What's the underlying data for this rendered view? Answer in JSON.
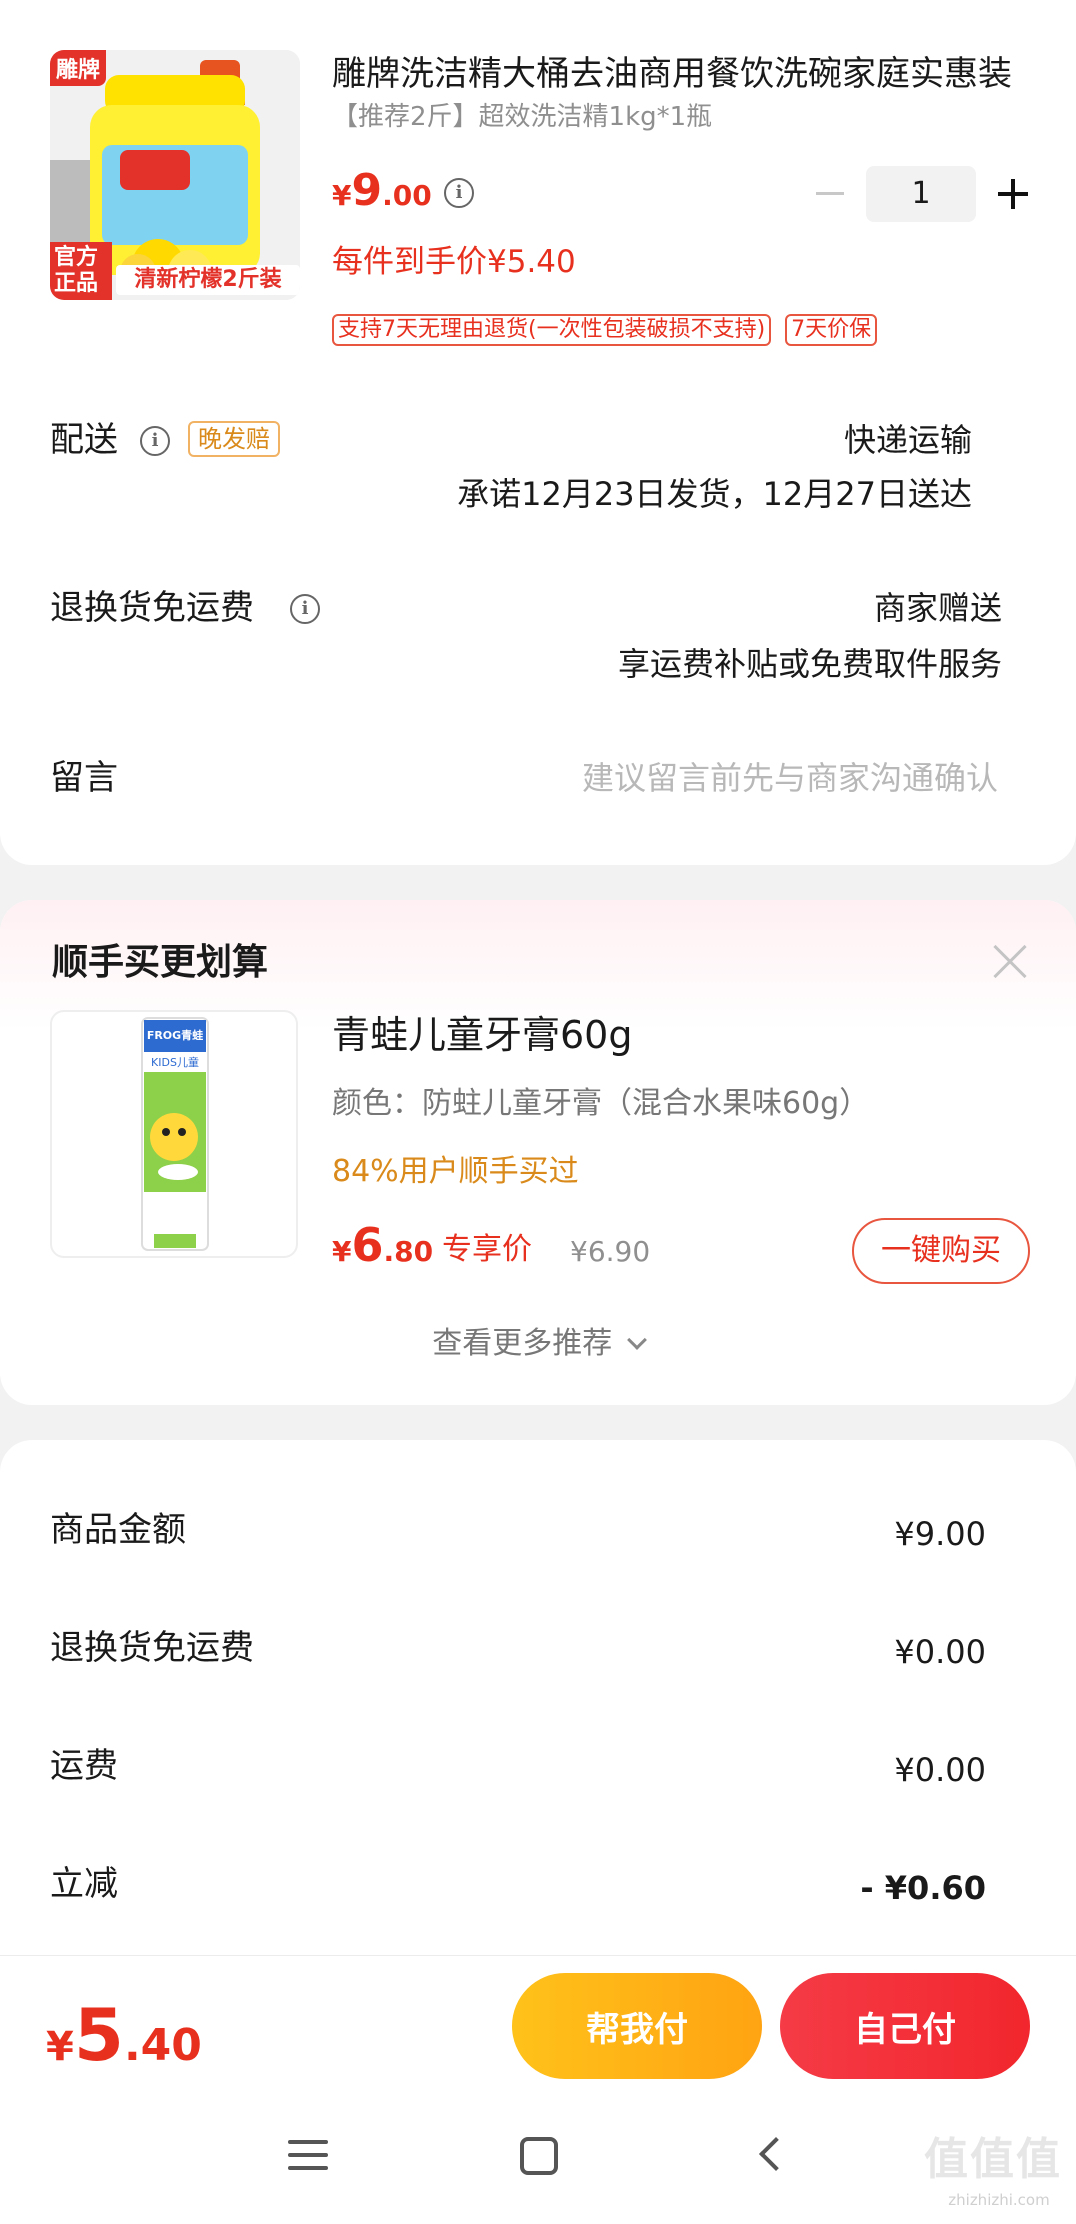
{
  "order_item": {
    "title": "雕牌洗洁精大桶去油商用餐饮洗碗家庭实惠装",
    "spec": "【推荐2斤】超效洗洁精1kg*1瓶",
    "image_badge_top": "雕牌",
    "image_badge_bottom_left": "官方正品",
    "image_badge_bottom_right": "清新柠檬2斤装",
    "price_symbol": "¥",
    "price_int": "9",
    "price_dec": ".00",
    "quantity": "1",
    "unit_price_text": "每件到手价¥5.40",
    "tags": [
      "支持7天无理由退货(一次性包装破损不支持)",
      "7天价保"
    ]
  },
  "delivery": {
    "label": "配送",
    "badge": "晚发赔",
    "method": "快递运输",
    "promise": "承诺12月23日发货，12月27日送达"
  },
  "return_freight": {
    "label": "退换货免运费",
    "value": "商家赠送",
    "desc": "享运费补贴或免费取件服务"
  },
  "message": {
    "label": "留言",
    "placeholder": "建议留言前先与商家沟通确认"
  },
  "recommend": {
    "title": "顺手买更划算",
    "product_name": "青蛙儿童牙膏60g",
    "spec": "颜色：防蛀儿童牙膏（混合水果味60g）",
    "bought_text": "84%用户顺手买过",
    "price_symbol": "¥",
    "price_int": "6",
    "price_dec": ".80",
    "exclusive_label": "专享价",
    "original_price": "¥6.90",
    "buy_button": "一键购买",
    "more_link": "查看更多推荐",
    "package_brand": "FROG青蛙",
    "package_kids": "KIDS儿童"
  },
  "summary": {
    "rows": [
      {
        "label": "商品金额",
        "value": "¥9.00"
      },
      {
        "label": "退换货免运费",
        "value": "¥0.00"
      },
      {
        "label": "运费",
        "value": "¥0.00"
      },
      {
        "label": "立减",
        "value": "- ¥0.60"
      }
    ]
  },
  "footer": {
    "total_symbol": "¥",
    "total_int": "5",
    "total_dec": ".40",
    "help_pay": "帮我付",
    "self_pay": "自己付"
  },
  "watermark": {
    "text": "值值值",
    "url": "zhizhizhi.com"
  },
  "colors": {
    "accent_red": "#e8301f",
    "accent_orange": "#d98a1a",
    "help_pay_gradient": [
      "#ffc21a",
      "#ffa312"
    ],
    "self_pay_gradient": [
      "#f53b46",
      "#f2262d"
    ]
  }
}
